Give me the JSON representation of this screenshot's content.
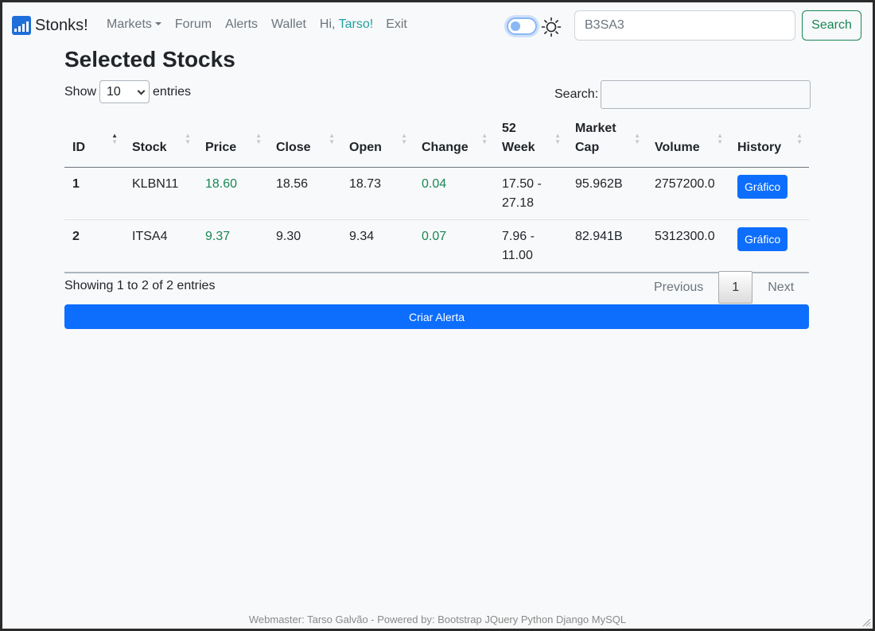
{
  "brand": {
    "name": "Stonks!"
  },
  "nav": {
    "items": [
      {
        "label": "Markets",
        "dropdown": true
      },
      {
        "label": "Forum"
      },
      {
        "label": "Alerts"
      },
      {
        "label": "Wallet"
      }
    ],
    "greeting_prefix": "Hi, ",
    "user_name": "Tarso",
    "greeting_suffix": "!",
    "exit_label": "Exit",
    "theme_toggle": {
      "on": false,
      "icon": "sun-icon"
    },
    "search_value": "B3SA3",
    "search_button": "Search"
  },
  "main": {
    "title": "Selected Stocks",
    "length": {
      "prefix": "Show",
      "value": "10",
      "suffix": "entries"
    },
    "filter_label": "Search:",
    "table": {
      "headers": [
        "ID",
        "Stock",
        "Price",
        "Close",
        "Open",
        "Change",
        "52 Week",
        "Market Cap",
        "Volume",
        "History"
      ],
      "rows": [
        {
          "id": "1",
          "stock": "KLBN11",
          "price": "18.60",
          "close": "18.56",
          "open": "18.73",
          "change": "0.04",
          "week52": "17.50 - 27.18",
          "market_cap": "95.962B",
          "volume": "2757200.0",
          "history": "Gráfico"
        },
        {
          "id": "2",
          "stock": "ITSA4",
          "price": "9.37",
          "close": "9.30",
          "open": "9.34",
          "change": "0.07",
          "week52": "7.96 - 11.00",
          "market_cap": "82.941B",
          "volume": "5312300.0",
          "history": "Gráfico"
        }
      ]
    },
    "info": "Showing 1 to 2 of 2 entries",
    "pagination": {
      "previous": "Previous",
      "current": "1",
      "next": "Next"
    },
    "alert_button": "Criar Alerta"
  },
  "footer": "Webmaster: Tarso Galvão - Powered by: Bootstrap JQuery Python Django MySQL",
  "colors": {
    "primary": "#0d6efd",
    "success": "#198754",
    "muted": "#6c757d",
    "user": "#20a0a0"
  }
}
